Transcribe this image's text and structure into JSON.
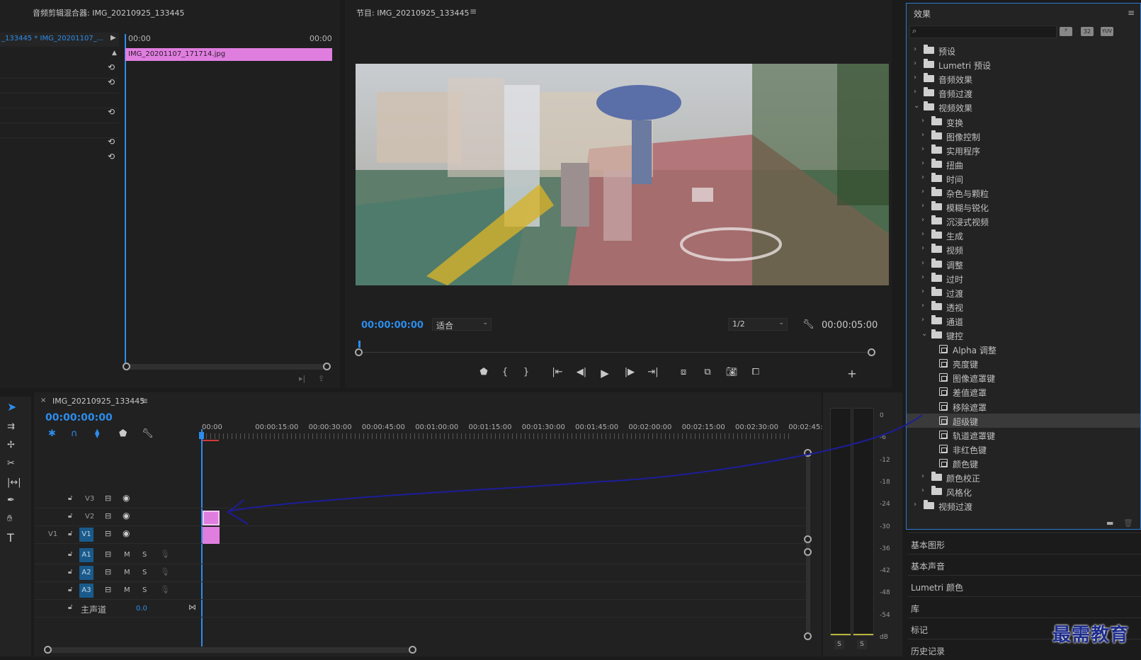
{
  "audio_mixer": {
    "title": "音频剪辑混合器: IMG_20210925_133445",
    "clip_path": "_133445 * IMG_20201107_...",
    "time_start": "00:00",
    "time_end": "00:00",
    "clip_name": "IMG_20201107_171714.jpg"
  },
  "program": {
    "title": "节目: IMG_20210925_133445",
    "timecode": "00:00:00:00",
    "fit_label": "适合",
    "resolution": "1/2",
    "duration": "00:00:05:00"
  },
  "timeline": {
    "title": "IMG_20210925_133445",
    "timecode": "00:00:00:00",
    "ruler": [
      "00:00",
      "00:00:15:00",
      "00:00:30:00",
      "00:00:45:00",
      "00:01:00:00",
      "00:01:15:00",
      "00:01:30:00",
      "00:01:45:00",
      "00:02:00:00",
      "00:02:15:00",
      "00:02:30:00",
      "00:02:45:"
    ],
    "tracks": {
      "v3": "V3",
      "v2": "V2",
      "v1_src": "V1",
      "v1": "V1",
      "a1": "A1",
      "a2": "A2",
      "a3": "A3",
      "m": "M",
      "s": "S",
      "master_label": "主声道",
      "master_value": "0.0"
    }
  },
  "meter": {
    "scale": [
      "0",
      "-6",
      "-12",
      "-18",
      "-24",
      "-30",
      "-36",
      "-42",
      "-48",
      "-54",
      "dB"
    ],
    "solo_left": "S",
    "solo_right": "S"
  },
  "effects": {
    "title": "效果",
    "search_placeholder": "",
    "tree": [
      {
        "label": "预设",
        "level": 0,
        "open": false,
        "kind": "folder"
      },
      {
        "label": "Lumetri 预设",
        "level": 0,
        "open": false,
        "kind": "folder"
      },
      {
        "label": "音频效果",
        "level": 0,
        "open": false,
        "kind": "folder"
      },
      {
        "label": "音频过渡",
        "level": 0,
        "open": false,
        "kind": "folder"
      },
      {
        "label": "视频效果",
        "level": 0,
        "open": true,
        "kind": "folder"
      },
      {
        "label": "变换",
        "level": 1,
        "open": false,
        "kind": "folder"
      },
      {
        "label": "图像控制",
        "level": 1,
        "open": false,
        "kind": "folder"
      },
      {
        "label": "实用程序",
        "level": 1,
        "open": false,
        "kind": "folder"
      },
      {
        "label": "扭曲",
        "level": 1,
        "open": false,
        "kind": "folder"
      },
      {
        "label": "时间",
        "level": 1,
        "open": false,
        "kind": "folder"
      },
      {
        "label": "杂色与颗粒",
        "level": 1,
        "open": false,
        "kind": "folder"
      },
      {
        "label": "模糊与锐化",
        "level": 1,
        "open": false,
        "kind": "folder"
      },
      {
        "label": "沉浸式视频",
        "level": 1,
        "open": false,
        "kind": "folder"
      },
      {
        "label": "生成",
        "level": 1,
        "open": false,
        "kind": "folder"
      },
      {
        "label": "视频",
        "level": 1,
        "open": false,
        "kind": "folder"
      },
      {
        "label": "调整",
        "level": 1,
        "open": false,
        "kind": "folder"
      },
      {
        "label": "过时",
        "level": 1,
        "open": false,
        "kind": "folder"
      },
      {
        "label": "过渡",
        "level": 1,
        "open": false,
        "kind": "folder"
      },
      {
        "label": "透视",
        "level": 1,
        "open": false,
        "kind": "folder"
      },
      {
        "label": "通道",
        "level": 1,
        "open": false,
        "kind": "folder"
      },
      {
        "label": "键控",
        "level": 1,
        "open": true,
        "kind": "folder"
      },
      {
        "label": "Alpha 调整",
        "level": 2,
        "kind": "effect"
      },
      {
        "label": "亮度键",
        "level": 2,
        "kind": "effect"
      },
      {
        "label": "图像遮罩键",
        "level": 2,
        "kind": "effect"
      },
      {
        "label": "差值遮罩",
        "level": 2,
        "kind": "effect"
      },
      {
        "label": "移除遮罩",
        "level": 2,
        "kind": "effect"
      },
      {
        "label": "超级键",
        "level": 2,
        "kind": "effect",
        "selected": true
      },
      {
        "label": "轨道遮罩键",
        "level": 2,
        "kind": "effect"
      },
      {
        "label": "非红色键",
        "level": 2,
        "kind": "effect"
      },
      {
        "label": "颜色键",
        "level": 2,
        "kind": "effect"
      },
      {
        "label": "颜色校正",
        "level": 1,
        "open": false,
        "kind": "folder"
      },
      {
        "label": "风格化",
        "level": 1,
        "open": false,
        "kind": "folder"
      },
      {
        "label": "视频过渡",
        "level": 0,
        "open": false,
        "kind": "folder"
      }
    ],
    "bottom_panels": [
      "基本图形",
      "基本声音",
      "Lumetri 颜色",
      "库",
      "标记",
      "历史记录"
    ]
  },
  "watermark": "最需教育",
  "colors": {
    "accent": "#2d8ceb",
    "clip": "#e07ee0",
    "selected_track": "#1a5a8a",
    "annotation": "#1d1d9a"
  }
}
